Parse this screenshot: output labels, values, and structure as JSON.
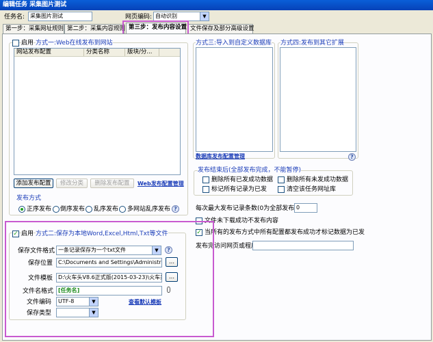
{
  "window": {
    "title": "编辑任务  采集图片测试"
  },
  "header": {
    "task_name_label": "任务名:",
    "task_name_value": "采集图片测试",
    "encoding_label": "网页编码:",
    "encoding_value": "自动识别"
  },
  "tabs": [
    {
      "label": "第一步：采集网址规则"
    },
    {
      "label": "第二步：采集内容规则"
    },
    {
      "label": "第三步：发布内容设置"
    },
    {
      "label": "文件保存及部分高级设置"
    }
  ],
  "method1": {
    "enable_label": "启用",
    "title": "方式一:Web在线发布到网站",
    "columns": [
      "网站发布配置",
      "分类名称",
      "版块/分..."
    ],
    "add_button": "添加发布配置",
    "modify_button": "修改分类",
    "delete_button": "删除发布配置",
    "manage_link": "Web发布配置管理",
    "publish_mode_label": "发布方式",
    "modes": [
      {
        "label": "正序发布",
        "selected": true
      },
      {
        "label": "倒序发布",
        "selected": false
      },
      {
        "label": "乱序发布",
        "selected": false
      },
      {
        "label": "多网站乱序发布",
        "selected": false
      }
    ]
  },
  "method3": {
    "title": "方式三:导入到自定义数据库",
    "manage_link": "数据库发布配置管理"
  },
  "method4": {
    "title": "方式四:发布到其它扩展"
  },
  "after_publish": {
    "title": "发布结束后(全部发布完成，不能暂停)",
    "options": [
      {
        "label": "删除所有已发成功数据",
        "checked": false
      },
      {
        "label": "删除所有未发成功数据",
        "checked": false
      },
      {
        "label": "标记所有记录为已发",
        "checked": false
      },
      {
        "label": "清空该任务网址库",
        "checked": false
      }
    ],
    "max_label": "每次最大发布记录条数(0为全部发布):",
    "max_value": "0",
    "no_download_label": "文件未下载成功不发布内容",
    "mark_label": "当所有的发布方式中所有配置都发布成功才标记数据为已发",
    "mark_checked": true,
    "program_label": "发布完访问网页或程序",
    "program_value": ""
  },
  "method2": {
    "enable_label": "启用",
    "enabled": true,
    "title": "方式二:保存为本地Word,Excel,Html,Txt等文件",
    "format_label": "保存文件格式",
    "format_value": "一条记录保存为一个txt文件",
    "location_label": "保存位置",
    "location_value": "C:\\Documents and Settings\\Administrat",
    "template_label": "文件模板",
    "template_value": "D:\\火车头V8.6正式版(2015-03-23)\\火车采",
    "filename_label": "文件名格式",
    "filename_value": "[任务名]",
    "encoding_label": "文件编码",
    "encoding_value": "UTF-8",
    "view_template_link": "查看默认模板",
    "type_label": "保存类型",
    "type_value": "",
    "browse_label": "..."
  },
  "colors": {
    "highlight": "#c85ad0",
    "link": "#1a3cb8",
    "title_bar": "#0a5fd8"
  }
}
